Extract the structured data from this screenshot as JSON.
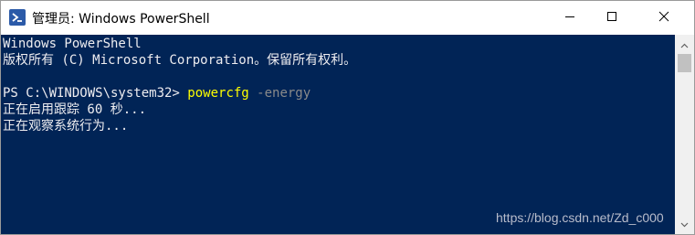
{
  "window": {
    "title": "管理员: Windows PowerShell"
  },
  "icons": {
    "app": "powershell-icon",
    "minimize": "minimize-icon",
    "maximize": "maximize-icon",
    "close": "close-icon",
    "scroll_up": "chevron-up-icon",
    "scroll_down": "chevron-down-icon"
  },
  "colors": {
    "console_background": "#012456",
    "console_text": "#eeedf0",
    "command_text": "#ffff00",
    "parameter_text": "#8a8a8a"
  },
  "console": {
    "lines": [
      "Windows PowerShell",
      "版权所有 (C) Microsoft Corporation。保留所有权利。",
      "",
      "正在启用跟踪 60 秒...",
      "正在观察系统行为..."
    ],
    "prompt": {
      "path": "PS C:\\WINDOWS\\system32> ",
      "command": "powercfg",
      "parameter": " -energy"
    }
  },
  "watermark": "https://blog.csdn.net/Zd_c000"
}
